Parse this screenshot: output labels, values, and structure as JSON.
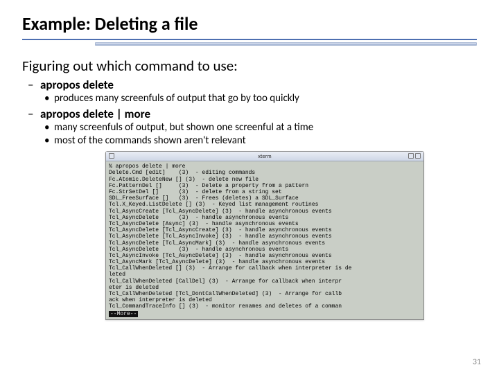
{
  "title": "Example: Deleting a file",
  "subhead": "Figuring out which command to use:",
  "bullets": {
    "b1": {
      "label": "apropos delete",
      "s1": "produces many screenfuls of output that go by too quickly"
    },
    "b2": {
      "label": "apropos delete | more",
      "s1": "many screenfuls of output, but shown one screenful at a time",
      "s2": "most of the commands shown aren't relevant"
    }
  },
  "terminal": {
    "title": "xterm",
    "lines": [
      "% apropos delete | more",
      "Delete.Cmd [edit]    (3)  - editing commands",
      "Fc.Atomic.DeleteNew [] (3)  - delete new file",
      "Fc.PatternDel []     (3)  - Delete a property from a pattern",
      "Fc.StrSetDel []      (3)  - delete from a string set",
      "SDL_FreeSurface []   (3)  - Frees (deletes) a SDL_Surface",
      "Tcl.X_Keyed.ListDelete [] (3)  - Keyed list management routines",
      "Tcl_AsyncCreate [Tcl_AsyncDelete] (3)  - handle asynchronous events",
      "Tcl_AsyncDelete      (3)  - handle asynchronous events",
      "Tcl_AsyncDelete [Async] (3)  - handle asynchronous events",
      "Tcl_AsyncDelete [Tcl_AsyncCreate] (3)  - handle asynchronous events",
      "Tcl_AsyncDelete [Tcl_AsyncInvoke] (3)  - handle asynchronous events",
      "Tcl_AsyncDelete [Tcl_AsyncMark] (3)  - handle asynchronous events",
      "Tcl_AsyncDelete      (3)  - handle asynchronous events",
      "Tcl_AsyncInvoke [Tcl_AsyncDelete] (3)  - handle asynchronous events",
      "Tcl_AsyncMark [Tcl_AsyncDelete] (3)  - handle asynchronous events",
      "Tcl_CallWhenDeleted [] (3)  - Arrange for callback when interpreter is de",
      "leted",
      "Tcl_CallWhenDeleted [CallDel] (3)  - Arrange for callback when interpr",
      "eter is deleted",
      "Tcl_CallWhenDeleted [Tcl_DontCallWhenDeleted] (3)  - Arrange for callb",
      "ack when interpreter is deleted",
      "Tcl_CommandTraceInfo [] (3)  - monitor renames and deletes of a comman"
    ],
    "more": "--More--"
  },
  "pagenum": "31"
}
